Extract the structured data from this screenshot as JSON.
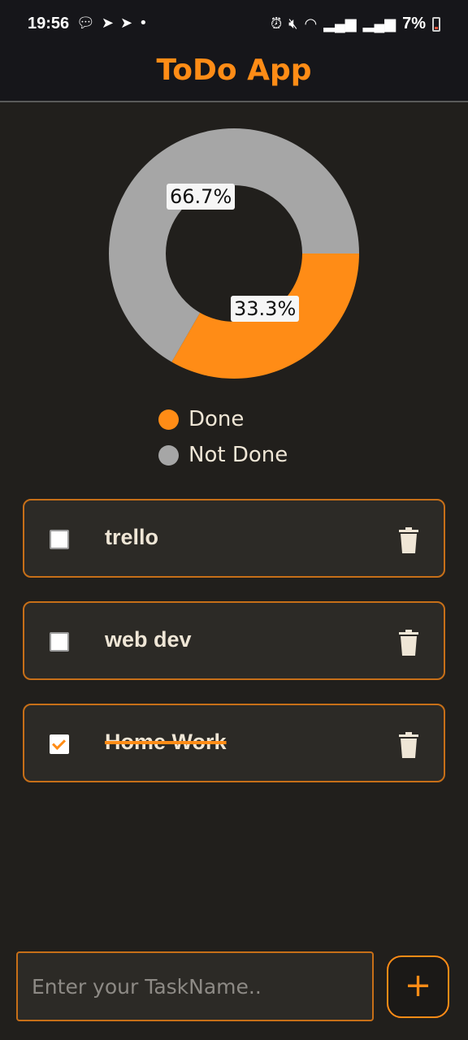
{
  "status_bar": {
    "time": "19:56",
    "left_icons": [
      "chat-bubble-icon",
      "telegram-icon",
      "telegram-icon",
      "dot-icon"
    ],
    "right_icons": [
      "alarm-icon",
      "mute-icon",
      "wifi-icon",
      "signal-icon",
      "signal-icon"
    ],
    "battery": "7%"
  },
  "app_bar": {
    "title": "ToDo App"
  },
  "colors": {
    "accent": "#ff8c16",
    "not_done": "#a6a6a6",
    "background": "#211f1c"
  },
  "chart_data": {
    "type": "pie",
    "donut": true,
    "categories": [
      "Done",
      "Not Done"
    ],
    "values": [
      33.3,
      66.7
    ],
    "labels": [
      "33.3%",
      "66.7%"
    ],
    "colors": [
      "#ff8c16",
      "#a6a6a6"
    ],
    "legend": "bottom"
  },
  "legend": [
    {
      "label": "Done",
      "color": "#ff8c16"
    },
    {
      "label": "Not Done",
      "color": "#a6a6a6"
    }
  ],
  "tasks": [
    {
      "name": "trello",
      "completed": false
    },
    {
      "name": "web dev",
      "completed": false
    },
    {
      "name": "Home Work",
      "completed": true
    }
  ],
  "input": {
    "placeholder": "Enter your TaskName..",
    "value": ""
  },
  "add_button": {
    "label": "+"
  }
}
